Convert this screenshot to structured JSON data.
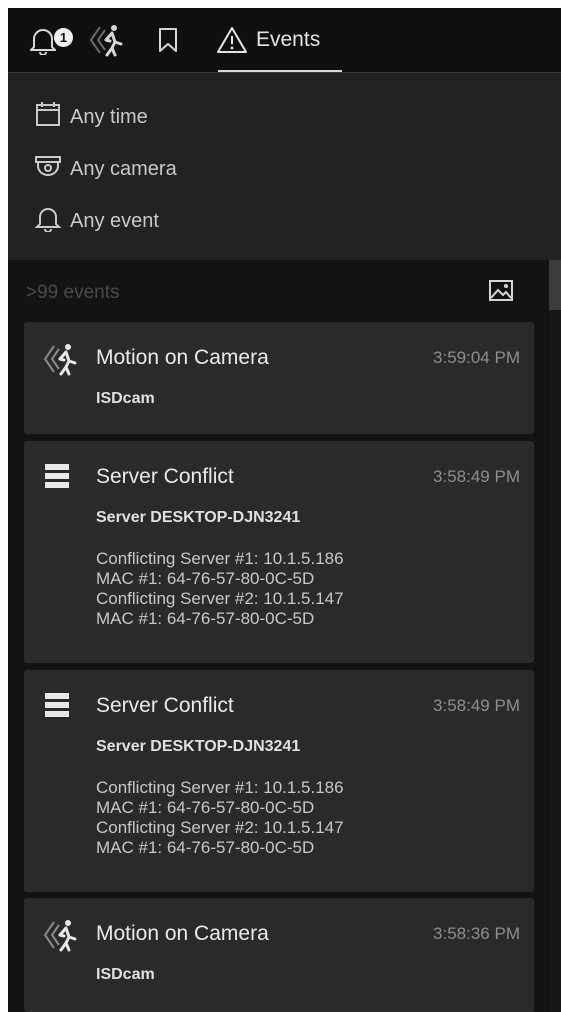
{
  "tabs": {
    "notifications_badge": "1",
    "events_label": "Events"
  },
  "filters": {
    "time": "Any time",
    "camera": "Any camera",
    "event": "Any event"
  },
  "results": {
    "count_label": ">99 events",
    "events": [
      {
        "icon": "motion-icon",
        "title": "Motion on Camera",
        "time": "3:59:04 PM",
        "source": "ISDcam",
        "details": []
      },
      {
        "icon": "server-icon",
        "title": "Server Conflict",
        "time": "3:58:49 PM",
        "source": "Server DESKTOP-DJN3241",
        "details": [
          "Conflicting Server #1: 10.1.5.186",
          "MAC #1: 64-76-57-80-0C-5D",
          "Conflicting Server #2: 10.1.5.147",
          "MAC #1: 64-76-57-80-0C-5D"
        ]
      },
      {
        "icon": "server-icon",
        "title": "Server Conflict",
        "time": "3:58:49 PM",
        "source": "Server DESKTOP-DJN3241",
        "details": [
          "Conflicting Server #1: 10.1.5.186",
          "MAC #1: 64-76-57-80-0C-5D",
          "Conflicting Server #2: 10.1.5.147",
          "MAC #1: 64-76-57-80-0C-5D"
        ]
      },
      {
        "icon": "motion-icon",
        "title": "Motion on Camera",
        "time": "3:58:36 PM",
        "source": "ISDcam",
        "details": []
      }
    ]
  }
}
